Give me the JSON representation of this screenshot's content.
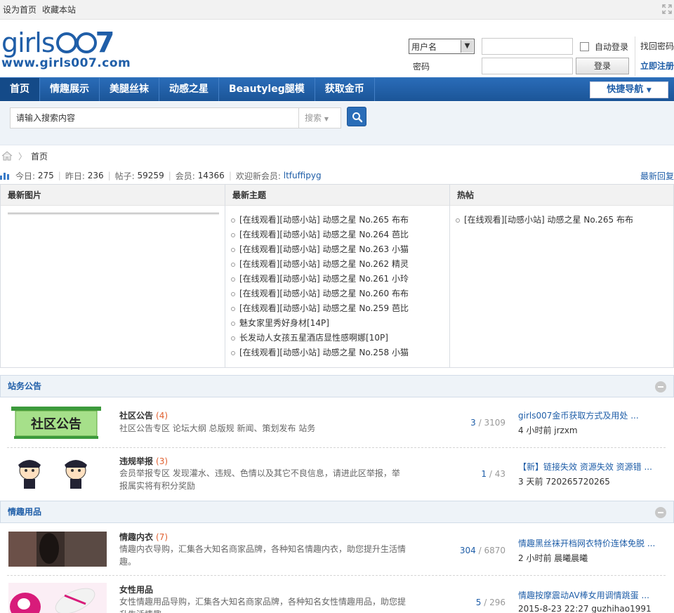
{
  "topbar": {
    "set_home": "设为首页",
    "bookmark": "收藏本站"
  },
  "logo": {
    "name": "girls",
    "url": "www.girls007.com"
  },
  "login": {
    "type_option": "用户名",
    "password_label": "密码",
    "auto_login": "自动登录",
    "login_button": "登录",
    "forgot": "找回密码",
    "register": "立即注册"
  },
  "nav": {
    "items": [
      "首页",
      "情趣展示",
      "美腿丝袜",
      "动感之星",
      "Beautyleg腿模",
      "获取金币"
    ],
    "quick": "快捷导航"
  },
  "search": {
    "placeholder": "请输入搜索内容",
    "type": "搜索"
  },
  "breadcrumb": {
    "home": "首页"
  },
  "stats": {
    "today_label": "今日:",
    "today": "275",
    "yesterday_label": "昨日:",
    "yesterday": "236",
    "posts_label": "帖子:",
    "posts": "59259",
    "members_label": "会员:",
    "members": "14366",
    "welcome_label": "欢迎新会员:",
    "newest_member": "ltfuffipyg",
    "latest_replies": "最新回复"
  },
  "portal": {
    "pics_title": "最新图片",
    "topics_title": "最新主题",
    "hot_title": "热帖",
    "topics": [
      "[在线观看][动感小站] 动感之星 No.265 布布",
      "[在线观看][动感小站] 动感之星 No.264 芭比",
      "[在线观看][动感小站] 动感之星 No.263 小猫",
      "[在线观看][动感小站] 动感之星 No.262 精灵",
      "[在线观看][动感小站] 动感之星 No.261 小玲",
      "[在线观看][动感小站] 动感之星 No.260 布布",
      "[在线观看][动感小站] 动感之星 No.259 芭比",
      "魅女家里秀好身材[14P]",
      "长发动人女孩五星酒店显性感啊娜[10P]",
      "[在线观看][动感小站] 动感之星 No.258 小猫"
    ],
    "hot": [
      "[在线观看][动感小站] 动感之星 No.265 布布"
    ]
  },
  "sections": [
    {
      "title": "站务公告",
      "forums": [
        {
          "name": "社区公告",
          "today": "(4)",
          "desc": "社区公告专区 论坛大纲 总版规 新闻、策划发布 站务",
          "threads": "3",
          "posts": "3109",
          "last_title": "girls007金币获取方式及用处 ...",
          "last_meta": "4 小时前 jrzxm",
          "img_text": "社区公告"
        },
        {
          "name": "违规举报",
          "today": "(3)",
          "desc": "会员举报专区 发现灌水、违规、色情以及其它不良信息，请进此区举报，举报属实将有积分奖励",
          "threads": "1",
          "posts": "43",
          "last_title": "【新】链接失效 资源失效 资源错 ...",
          "last_meta": "3 天前 720265720265"
        }
      ]
    },
    {
      "title": "情趣用品",
      "forums": [
        {
          "name": "情趣内衣",
          "today": "(7)",
          "desc": "情趣内衣导购，汇集各大知名商家品牌，各种知名情趣内衣，助您提升生活情趣。",
          "threads": "304",
          "posts": "6870",
          "last_title": "情趣黑丝袜开档网衣特价连体免脱 ...",
          "last_meta": "2 小时前 晨曦晨曦"
        },
        {
          "name": "女性用品",
          "today": "",
          "desc": "女性情趣用品导购，汇集各大知名商家品牌，各种知名女性情趣用品，助您提升生活情趣。",
          "threads": "5",
          "posts": "296",
          "last_title": "情趣按摩震动AV棒女用调情跳蛋 ...",
          "last_meta": "2015-8-23 22:27 guzhihao1991"
        }
      ]
    }
  ],
  "colors": {
    "brand": "#1f5ea8",
    "nav": "#1b5598",
    "count_today": "#e06030"
  }
}
